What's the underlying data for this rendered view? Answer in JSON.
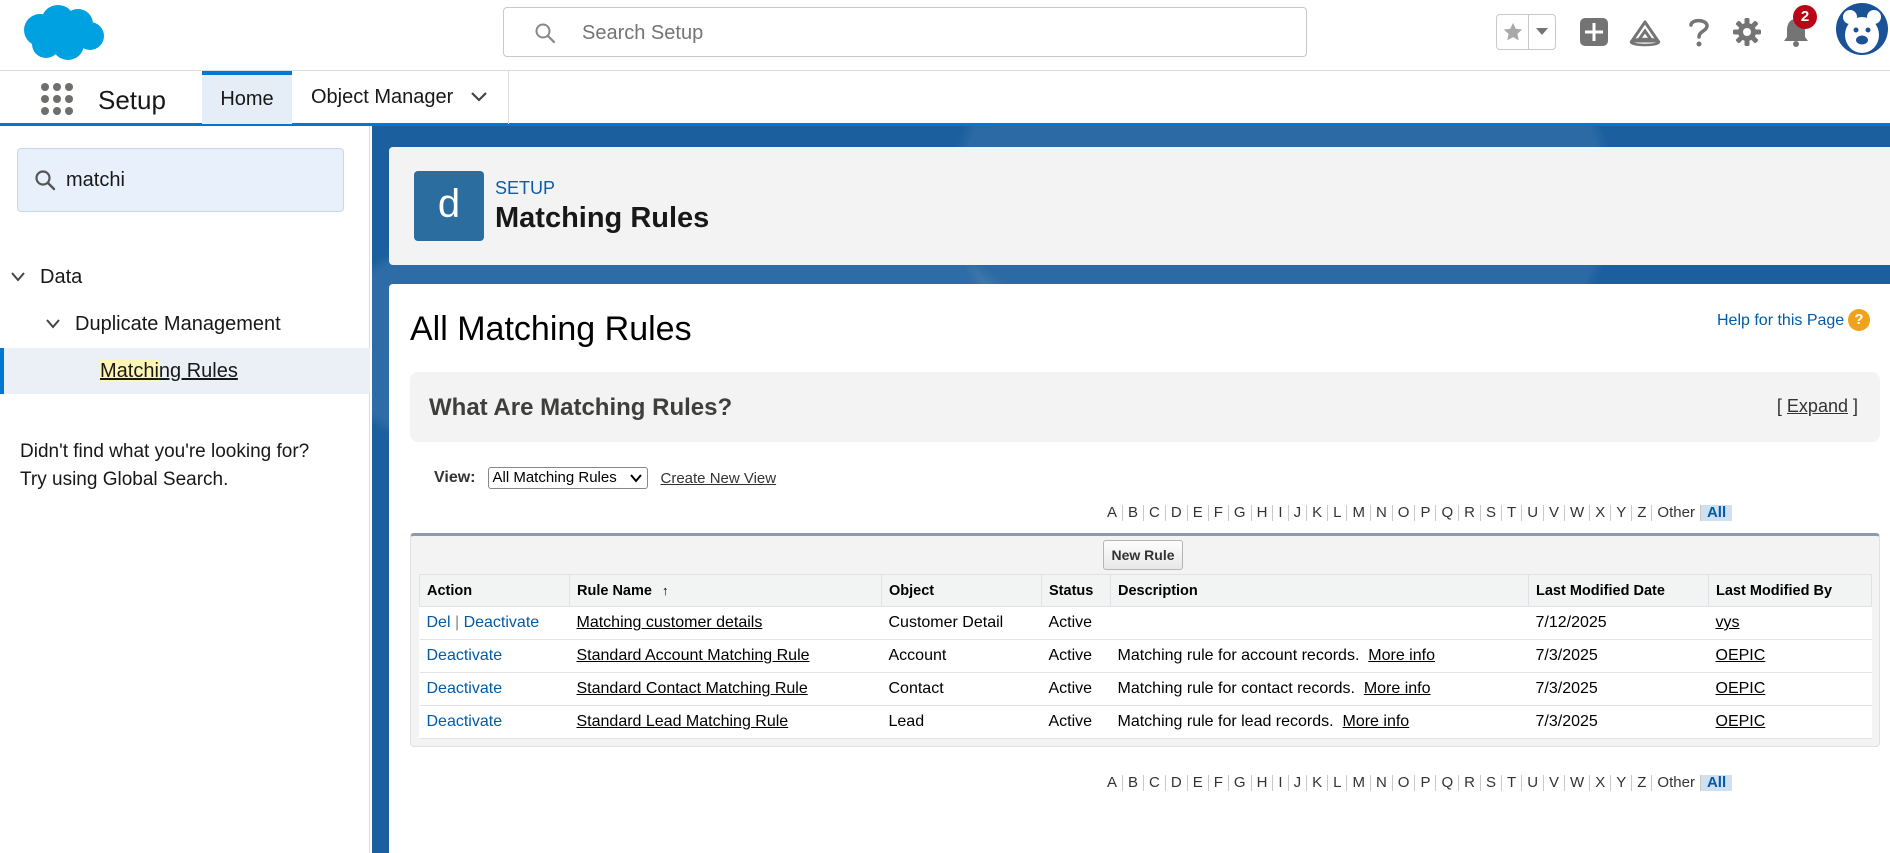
{
  "header": {
    "search_placeholder": "Search Setup",
    "notification_count": "2",
    "icons": [
      "star-icon",
      "chevron-down-icon",
      "plus-icon",
      "trailhead-icon",
      "help-icon",
      "gear-icon",
      "bell-icon",
      "avatar"
    ]
  },
  "nav": {
    "app_name": "Setup",
    "tabs": [
      {
        "label": "Home"
      },
      {
        "label": "Object Manager"
      }
    ]
  },
  "sidebar": {
    "quick_find": "matchi",
    "tree": [
      {
        "label": "Data"
      },
      {
        "label": "Duplicate Management"
      },
      {
        "label_highlight": "Matchi",
        "label_rest": "ng Rules"
      }
    ],
    "not_found_line1": "Didn't find what you're looking for?",
    "not_found_line2": "Try using Global Search."
  },
  "page_header": {
    "icon_letter": "d",
    "eyebrow": "SETUP",
    "title": "Matching Rules"
  },
  "content": {
    "title": "All Matching Rules",
    "help_link": "Help for this Page",
    "help_icon": "?",
    "info_title": "What Are Matching Rules?",
    "expand_open": "[ ",
    "expand_label": "Expand",
    "expand_close": " ]",
    "view_label": "View:",
    "view_selected": "All Matching Rules",
    "create_view": "Create New View",
    "alphabet": [
      "A",
      "B",
      "C",
      "D",
      "E",
      "F",
      "G",
      "H",
      "I",
      "J",
      "K",
      "L",
      "M",
      "N",
      "O",
      "P",
      "Q",
      "R",
      "S",
      "T",
      "U",
      "V",
      "W",
      "X",
      "Y",
      "Z",
      "Other",
      "All"
    ],
    "new_rule": "New Rule",
    "columns": [
      "Action",
      "Rule Name",
      "Object",
      "Status",
      "Description",
      "Last Modified Date",
      "Last Modified By"
    ],
    "sort_indicator": "↑",
    "rows": [
      {
        "action1": "Del",
        "action_sep": " | ",
        "action2": "Deactivate",
        "name": "Matching customer details",
        "object": "Customer Detail",
        "status": "Active",
        "description": "",
        "more": "",
        "date": "7/12/2025",
        "by": "vys"
      },
      {
        "action1": "",
        "action_sep": "",
        "action2": "Deactivate",
        "name": "Standard Account Matching Rule",
        "object": "Account",
        "status": "Active",
        "description": "Matching rule for account records.",
        "more": "More info",
        "date": "7/3/2025",
        "by": "OEPIC"
      },
      {
        "action1": "",
        "action_sep": "",
        "action2": "Deactivate",
        "name": "Standard Contact Matching Rule",
        "object": "Contact",
        "status": "Active",
        "description": "Matching rule for contact records.",
        "more": "More info",
        "date": "7/3/2025",
        "by": "OEPIC"
      },
      {
        "action1": "",
        "action_sep": "",
        "action2": "Deactivate",
        "name": "Standard Lead Matching Rule",
        "object": "Lead",
        "status": "Active",
        "description": "Matching rule for lead records.",
        "more": "More info",
        "date": "7/3/2025",
        "by": "OEPIC"
      }
    ]
  },
  "colors": {
    "brand_blue": "#0176d3",
    "link_blue": "#015ba7",
    "notification_red": "#ba0517"
  }
}
